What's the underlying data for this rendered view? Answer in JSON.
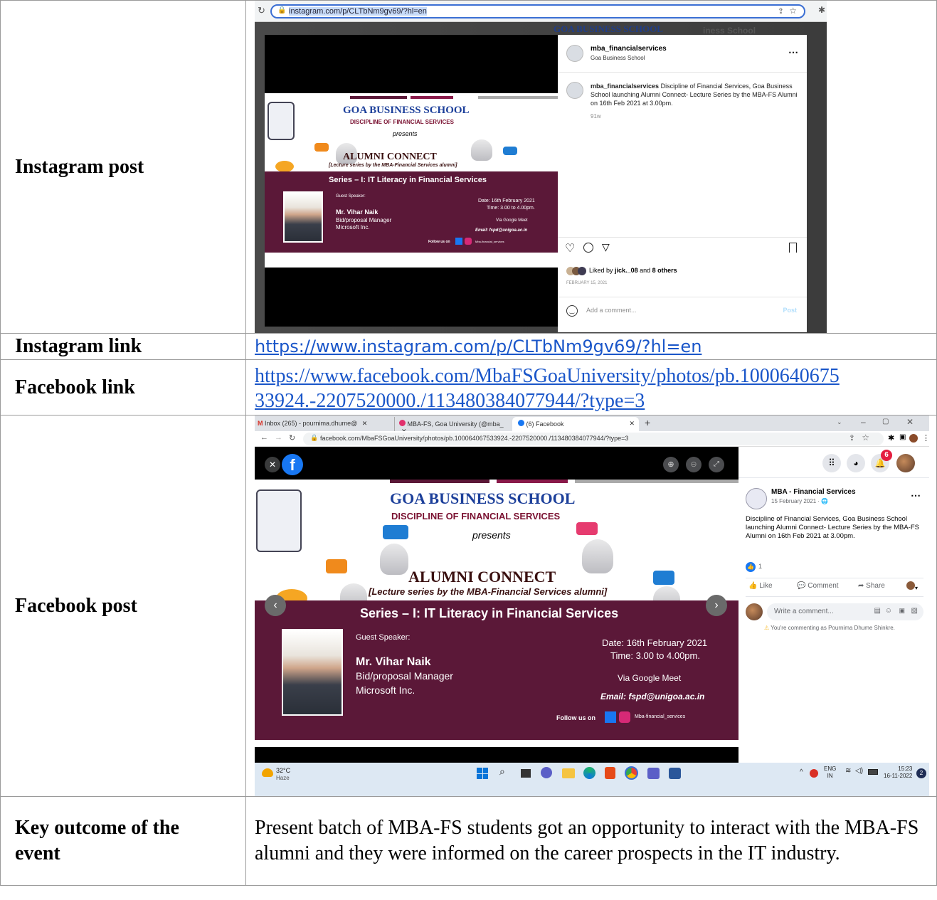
{
  "rows": {
    "instagram_post": {
      "label": "Instagram post"
    },
    "instagram_link": {
      "label": "Instagram link",
      "url": "https://www.instagram.com/p/CLTbNm9gv69/?hl=en"
    },
    "facebook_link": {
      "label": "Facebook link",
      "url_line1": "https://www.facebook.com/MbaFSGoaUniversity/photos/pb.1000640675",
      "url_line2": "33924.-2207520000./113480384077944/?type=3"
    },
    "facebook_post": {
      "label": "Facebook post"
    },
    "key_outcome": {
      "label_line1": "Key outcome of the",
      "label_line2": "event",
      "text": "Present batch of MBA-FS students got an opportunity to interact with the MBA-FS alumni and they were informed on the career prospects in the IT industry."
    }
  },
  "instagram_screenshot": {
    "address": "instagram.com/p/CLTbNm9gv69/?hl=en",
    "bg_title": "GOA BUSINESS SCHOOL",
    "bg_title2": "iness School",
    "username": "mba_financialservices",
    "location": "Goa Business School",
    "caption_user": "mba_financialservices",
    "caption": "Discipline of Financial Services, Goa Business School launching Alumni Connect- Lecture Series by the MBA-FS Alumni on 16th Feb 2021 at 3.00pm.",
    "age": "91w",
    "liked_by": "Liked by",
    "liked_user": "jick._08",
    "liked_and": "and",
    "liked_others": "8 others",
    "date": "FEBRUARY 15, 2021",
    "comment_placeholder": "Add a comment...",
    "post_button": "Post"
  },
  "poster": {
    "school": "GOA BUSINESS SCHOOL",
    "discipline": "DISCIPLINE OF FINANCIAL SERVICES",
    "presents": "presents",
    "event": "ALUMNI CONNECT",
    "subtitle": "[Lecture series by the MBA-Financial Services alumni]",
    "series": "Series – I: IT Literacy in Financial Services",
    "guest_label": "Guest Speaker:",
    "speaker": "Mr. Vihar Naik",
    "role": "Bid/proposal Manager",
    "company": "Microsoft Inc.",
    "date": "Date: 16th February 2021",
    "time": "Time: 3.00 to 4.00pm.",
    "via": "Via Google Meet",
    "email": "Email: fspd@unigoa.ac.in",
    "follow": "Follow us on",
    "handle": "Mba-financial_services"
  },
  "facebook_screenshot": {
    "tabs": [
      {
        "label": "Inbox (265) - pournima.dhume@"
      },
      {
        "label": "MBA-FS, Goa University (@mba_"
      },
      {
        "label": "(6) Facebook"
      }
    ],
    "address": "facebook.com/MbaFSGoaUniversity/photos/pb.100064067533924.-2207520000./113480384077944/?type=3",
    "notif_count": "6",
    "page_name": "MBA - Financial Services",
    "post_date": "15 February 2021 ·",
    "caption": "Discipline of Financial Services, Goa Business School launching Alumni Connect- Lecture Series by the MBA-FS Alumni on 16th Feb 2021 at 3.00pm.",
    "reactions": "1",
    "like": "Like",
    "comment": "Comment",
    "share": "Share",
    "comment_placeholder": "Write a comment...",
    "commenting_as": "You're commenting as Pournima Dhume Shinkre.",
    "weather_temp": "32°C",
    "weather_desc": "Haze",
    "lang": "ENG",
    "lang_region": "IN",
    "clock_time": "15:23",
    "clock_date": "16-11-2022",
    "notif_badge": "2"
  },
  "colors": {
    "link": "#1a56c9",
    "poster_band": "#5b1838",
    "taskbar": "#dde8f3"
  }
}
